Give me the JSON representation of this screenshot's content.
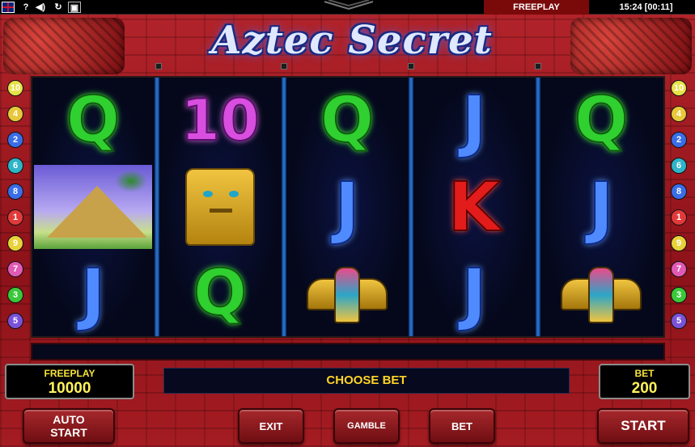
{
  "topbar": {
    "help_label": "?",
    "freeplay_label": "FREEPLAY",
    "clock": "15:24 [00:11]"
  },
  "title": "Aztec Secret",
  "paylines_left": [
    "10",
    "4",
    "2",
    "6",
    "8",
    "1",
    "9",
    "7",
    "3",
    "5"
  ],
  "paylines_right": [
    "10",
    "4",
    "2",
    "6",
    "8",
    "1",
    "9",
    "7",
    "3",
    "5"
  ],
  "payline_colors": {
    "10": "#e8e24a",
    "4": "#e8c83a",
    "2": "#3a6ee8",
    "6": "#2fb4c8",
    "8": "#3a6ee8",
    "1": "#e23a3a",
    "9": "#e8d23a",
    "7": "#e05ab4",
    "3": "#3ac83a",
    "5": "#7a52d8"
  },
  "reels": [
    [
      {
        "kind": "q",
        "text": "Q"
      },
      {
        "kind": "pyramid",
        "text": ""
      },
      {
        "kind": "j",
        "text": "J"
      }
    ],
    [
      {
        "kind": "ten",
        "text": "10"
      },
      {
        "kind": "idol",
        "text": ""
      },
      {
        "kind": "q",
        "text": "Q"
      }
    ],
    [
      {
        "kind": "q",
        "text": "Q"
      },
      {
        "kind": "j",
        "text": "J"
      },
      {
        "kind": "eagle",
        "text": ""
      }
    ],
    [
      {
        "kind": "j",
        "text": "J"
      },
      {
        "kind": "k",
        "text": "K"
      },
      {
        "kind": "j",
        "text": "J"
      }
    ],
    [
      {
        "kind": "q",
        "text": "Q"
      },
      {
        "kind": "j",
        "text": "J"
      },
      {
        "kind": "eagle",
        "text": ""
      }
    ]
  ],
  "credit": {
    "label": "FREEPLAY",
    "value": "10000"
  },
  "bet": {
    "label": "BET",
    "value": "200"
  },
  "message": "CHOOSE BET",
  "buttons": {
    "auto_start_line1": "AUTO",
    "auto_start_line2": "START",
    "exit": "EXIT",
    "gamble": "GAMBLE",
    "bet": "BET",
    "start": "START"
  }
}
